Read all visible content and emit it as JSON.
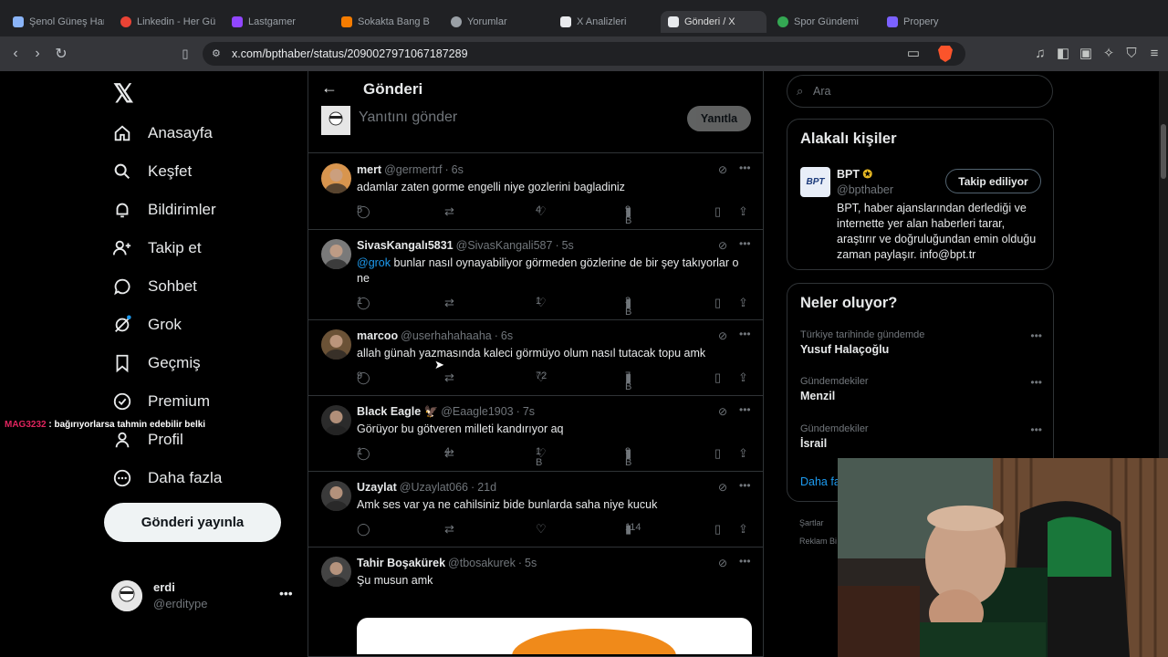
{
  "browser": {
    "tabs": [
      {
        "label": "Şenol Güneş Hangi",
        "color": "#8ab4f8"
      },
      {
        "label": "Linkedin - Her Gün",
        "color": "#ea4335"
      },
      {
        "label": "Lastgamer",
        "color": "#9146ff"
      },
      {
        "label": "Sokakta Bang B",
        "color": "#f57c00"
      },
      {
        "label": "Yorumlar",
        "color": "#9aa0a6"
      },
      {
        "label": "X Analizleri",
        "color": "#e8eaed"
      },
      {
        "label": "Gönderi / X",
        "color": "#e8eaed"
      },
      {
        "label": "Spor Gündemi",
        "color": "#34a853"
      },
      {
        "label": "Propery",
        "color": "#7b61ff"
      }
    ],
    "url": "x.com/bpthaber/status/2090027971067187289"
  },
  "leftnav": {
    "items": [
      {
        "label": "Anasayfa",
        "icon": "home-icon"
      },
      {
        "label": "Keşfet",
        "icon": "search-icon"
      },
      {
        "label": "Bildirimler",
        "icon": "bell-icon"
      },
      {
        "label": "Takip et",
        "icon": "person-plus-icon"
      },
      {
        "label": "Sohbet",
        "icon": "chat-icon"
      },
      {
        "label": "Grok",
        "icon": "grok-icon"
      },
      {
        "label": "Geçmiş",
        "icon": "bookmark-icon"
      },
      {
        "label": "Premium",
        "icon": "verified-icon"
      },
      {
        "label": "Profil",
        "icon": "person-icon"
      },
      {
        "label": "Daha fazla",
        "icon": "more-circle-icon"
      }
    ],
    "post_button": "Gönderi yayınla",
    "account": {
      "name": "erdi",
      "handle": "@erditype"
    }
  },
  "chat_overlay": {
    "user": "MAG3232",
    "message": ": bağırıyorlarsa tahmin edebilir belki"
  },
  "main": {
    "title": "Gönderi",
    "reply_placeholder": "Yanıtını gönder",
    "reply_button": "Yanıtla",
    "tweets": [
      {
        "name": "mert",
        "handle": "@germertrf",
        "time": "6s",
        "text": "adamlar zaten gorme engelli niye gozlerini bagladiniz",
        "replies": "5",
        "retweets": "",
        "likes": "4",
        "views": "9 B"
      },
      {
        "name": "SivasKangalı5831",
        "handle": "@SivasKangali587",
        "time": "5s",
        "mention": "@grok",
        "text": " bunlar nasıl oynayabiliyor görmeden gözlerine de bir şey takıyorlar o ne",
        "replies": "1",
        "retweets": "",
        "likes": "1",
        "views": "3 B"
      },
      {
        "name": "marcoo",
        "handle": "@userhahahaaha",
        "time": "6s",
        "text": "allah günah yazmasında kaleci görmüyo olum nasıl tutacak topu amk",
        "replies": "9",
        "retweets": "",
        "likes": "72",
        "views": "7 B"
      },
      {
        "name": "Black Eagle 🦅",
        "handle": "@Eaagle1903",
        "time": "7s",
        "text": "Görüyor bu götveren milleti kandırıyor aq",
        "replies": "1",
        "retweets": "4",
        "likes": "1 B",
        "views": "9 B"
      },
      {
        "name": "Uzaylat",
        "handle": "@Uzaylat066",
        "time": "21d",
        "text": "Amk ses var ya ne cahilsiniz bide bunlarda saha niye kucuk",
        "replies": "",
        "retweets": "",
        "likes": "",
        "views": "114"
      },
      {
        "name": "Tahir Boşakürek",
        "handle": "@tbosakurek",
        "time": "5s",
        "text": "Şu musun amk",
        "replies": "",
        "retweets": "",
        "likes": "",
        "views": ""
      }
    ]
  },
  "right": {
    "search_placeholder": "Ara",
    "related_title": "Alakalı kişiler",
    "bpt": {
      "name": "BPT",
      "handle": "@bpthaber",
      "bio": "BPT, haber ajanslarından derlediği ve internette yer alan haberleri tarar, araştırır ve doğruluğundan emin olduğu zaman paylaşır. info@bpt.tr",
      "follow": "Takip ediliyor",
      "logo": "BPT"
    },
    "trends_title": "Neler oluyor?",
    "trends": [
      {
        "context": "Türkiye tarihinde gündemde",
        "title": "Yusuf Halaçoğlu"
      },
      {
        "context": "Gündemdekiler",
        "title": "Menzil"
      },
      {
        "context": "Gündemdekiler",
        "title": "İsrail"
      }
    ],
    "show_more": "Daha fa",
    "footer1": "Şartlar",
    "footer2": "Reklam Bi"
  },
  "colors": {
    "accent": "#1d9bf0",
    "bg": "#000000",
    "border": "#2f3336",
    "muted": "#71767b"
  }
}
